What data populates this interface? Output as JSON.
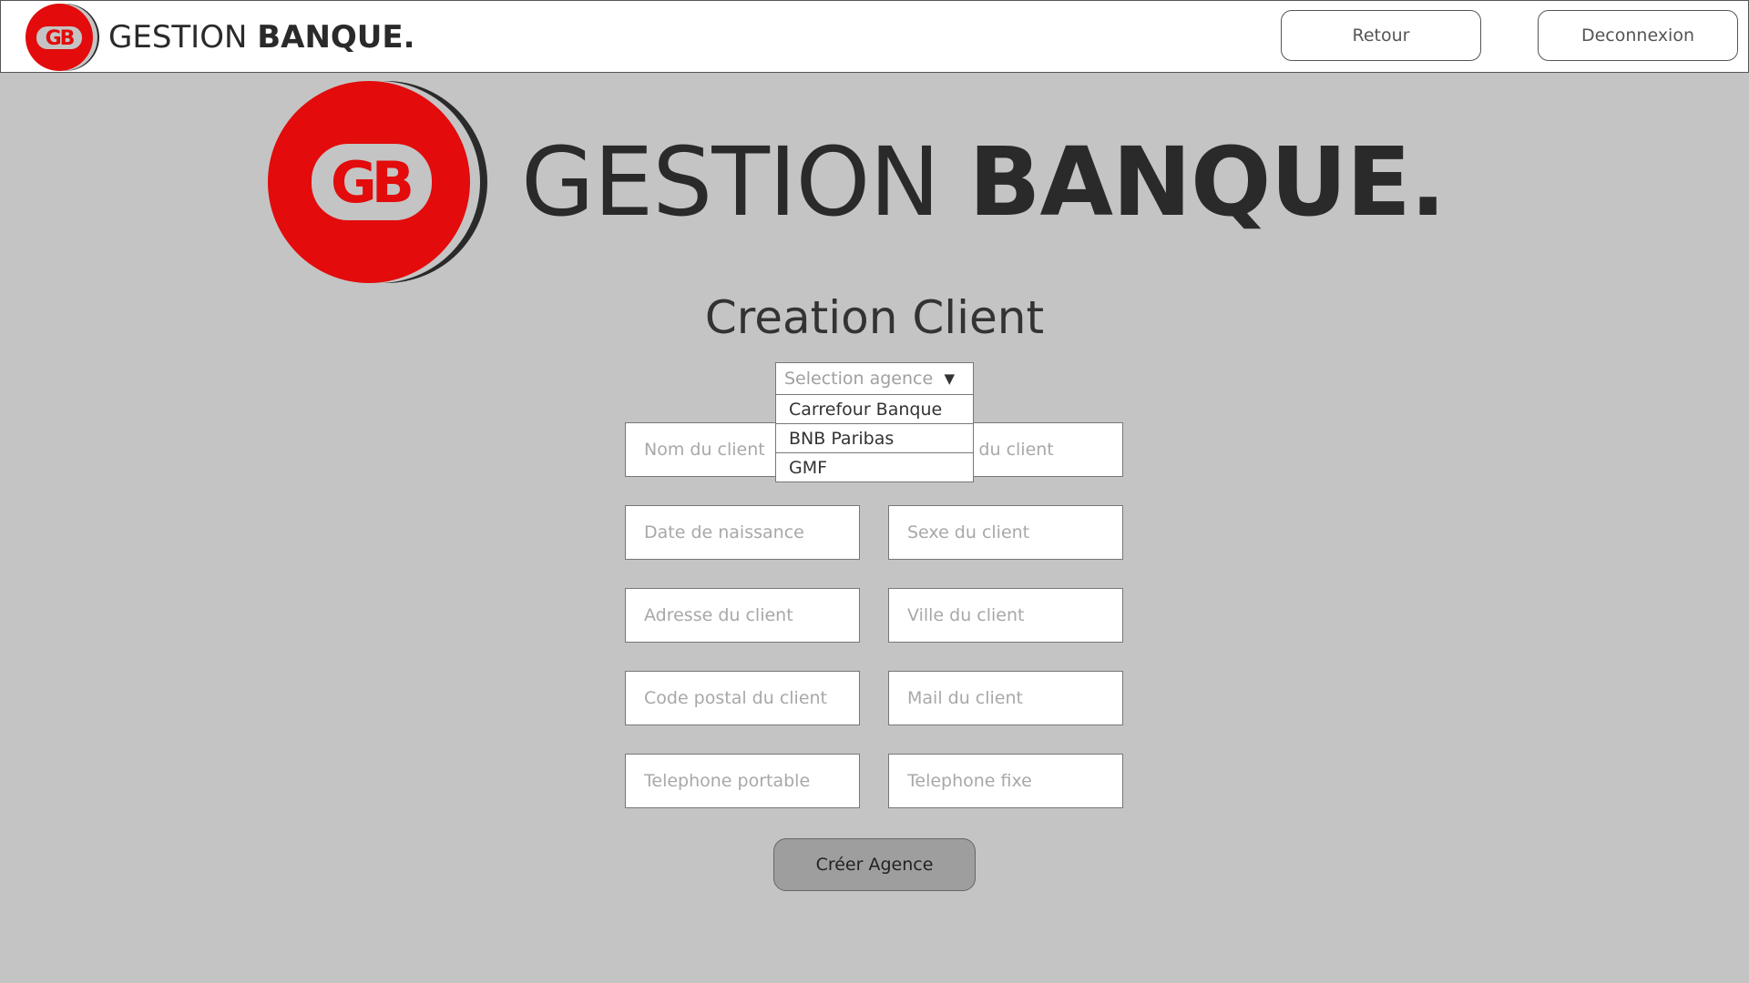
{
  "header": {
    "logo_monogram": "GB",
    "brand_light": "GESTION ",
    "brand_bold": "BANQUE.",
    "back_label": "Retour",
    "logout_label": "Deconnexion"
  },
  "hero": {
    "logo_monogram": "GB",
    "brand_light": "GESTION ",
    "brand_bold": "BANQUE."
  },
  "page_title": "Creation Client",
  "agency_select": {
    "placeholder": "Selection agence",
    "options": [
      "Carrefour Banque",
      "BNB Paribas",
      "GMF"
    ]
  },
  "form": {
    "nom": "Nom du client",
    "prenom": "Prenom du client",
    "naissance": "Date de naissance",
    "sexe": "Sexe du client",
    "adresse": "Adresse du client",
    "ville": "Ville du client",
    "code_postal": "Code postal du client",
    "mail": "Mail du client",
    "tel_portable": "Telephone portable",
    "tel_fixe": "Telephone fixe"
  },
  "submit_label": "Créer Agence",
  "colors": {
    "brand_red": "#e30b0b",
    "dark": "#2a2a2a",
    "background": "#c4c4c4"
  }
}
